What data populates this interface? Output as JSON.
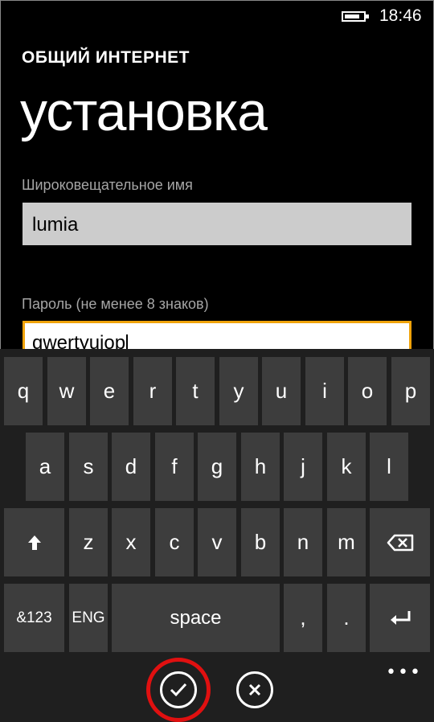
{
  "status_bar": {
    "battery_icon": "battery-icon",
    "battery_level": 0.65,
    "time": "18:46"
  },
  "app_title": "ОБЩИЙ ИНТЕРНЕТ",
  "page_title": "установка",
  "broadcast_name": {
    "label": "Широковещательное имя",
    "value": "lumia"
  },
  "password": {
    "label": "Пароль (не менее 8 знаков)",
    "value": "qwertyuiop"
  },
  "keyboard": {
    "row1": [
      "q",
      "w",
      "e",
      "r",
      "t",
      "y",
      "u",
      "i",
      "o",
      "p"
    ],
    "row2": [
      "a",
      "s",
      "d",
      "f",
      "g",
      "h",
      "j",
      "k",
      "l"
    ],
    "row3": [
      "z",
      "x",
      "c",
      "v",
      "b",
      "n",
      "m"
    ],
    "shift_icon": "shift-arrow-icon",
    "backspace_icon": "backspace-icon",
    "symbols_label": "&123",
    "language_label": "ENG",
    "space_label": "space",
    "comma_label": ",",
    "period_label": ".",
    "enter_icon": "enter-icon"
  },
  "app_bar": {
    "confirm_icon": "check-icon",
    "cancel_icon": "close-icon",
    "more_label": "•••",
    "highlight_color": "#e01010"
  },
  "colors": {
    "accent": "#f0a30a",
    "key": "#3d3d3d",
    "keyboard_bg": "#1f1f1f"
  }
}
